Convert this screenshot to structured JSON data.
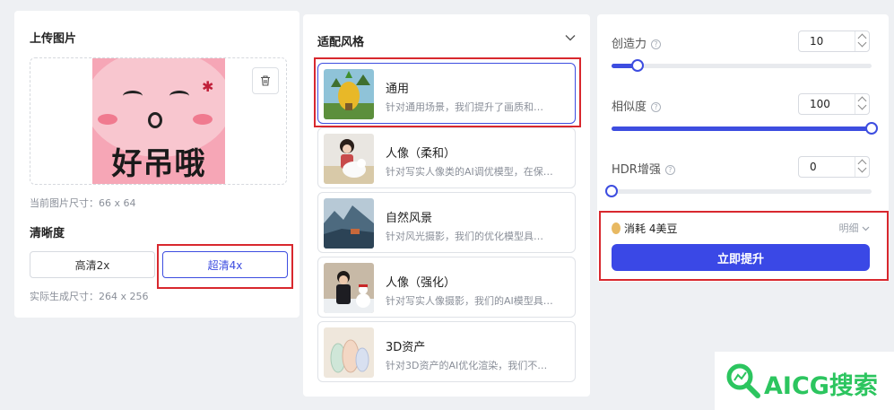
{
  "upload": {
    "title": "上传图片",
    "current_size": "当前图片尺寸：66 x 64",
    "image_caption": "好吊哦",
    "clarity_title": "清晰度",
    "options": [
      "高清2x",
      "超清4x"
    ],
    "selected": "超清4x",
    "output_size": "实际生成尺寸：264 x 256"
  },
  "styles": {
    "title": "适配风格",
    "items": [
      {
        "name": "通用",
        "desc": "针对通用场景，我们提升了画质和…",
        "active": true
      },
      {
        "name": "人像（柔和）",
        "desc": "针对写实人像类的AI调优模型，在保…",
        "active": false
      },
      {
        "name": "自然风景",
        "desc": "针对风光摄影，我们的优化模型具…",
        "active": false
      },
      {
        "name": "人像（强化）",
        "desc": "针对写实人像摄影，我们的AI模型具…",
        "active": false
      },
      {
        "name": "3D资产",
        "desc": "针对3D资产的AI优化渲染，我们不…",
        "active": false
      }
    ]
  },
  "params": {
    "creativity": {
      "label": "创造力",
      "value": "10",
      "fraction": 0.1
    },
    "similarity": {
      "label": "相似度",
      "value": "100",
      "fraction": 1.0
    },
    "hdr": {
      "label": "HDR增强",
      "value": "0",
      "fraction": 0.0
    },
    "help_glyph": "?"
  },
  "cost": {
    "label": "消耗 4美豆",
    "detail": "明细"
  },
  "submit_label": "立即提升",
  "watermark": "AICG搜索",
  "colors": {
    "accent": "#3d4de0",
    "highlight_box": "#d8282e",
    "watermark": "#2cc55f"
  }
}
